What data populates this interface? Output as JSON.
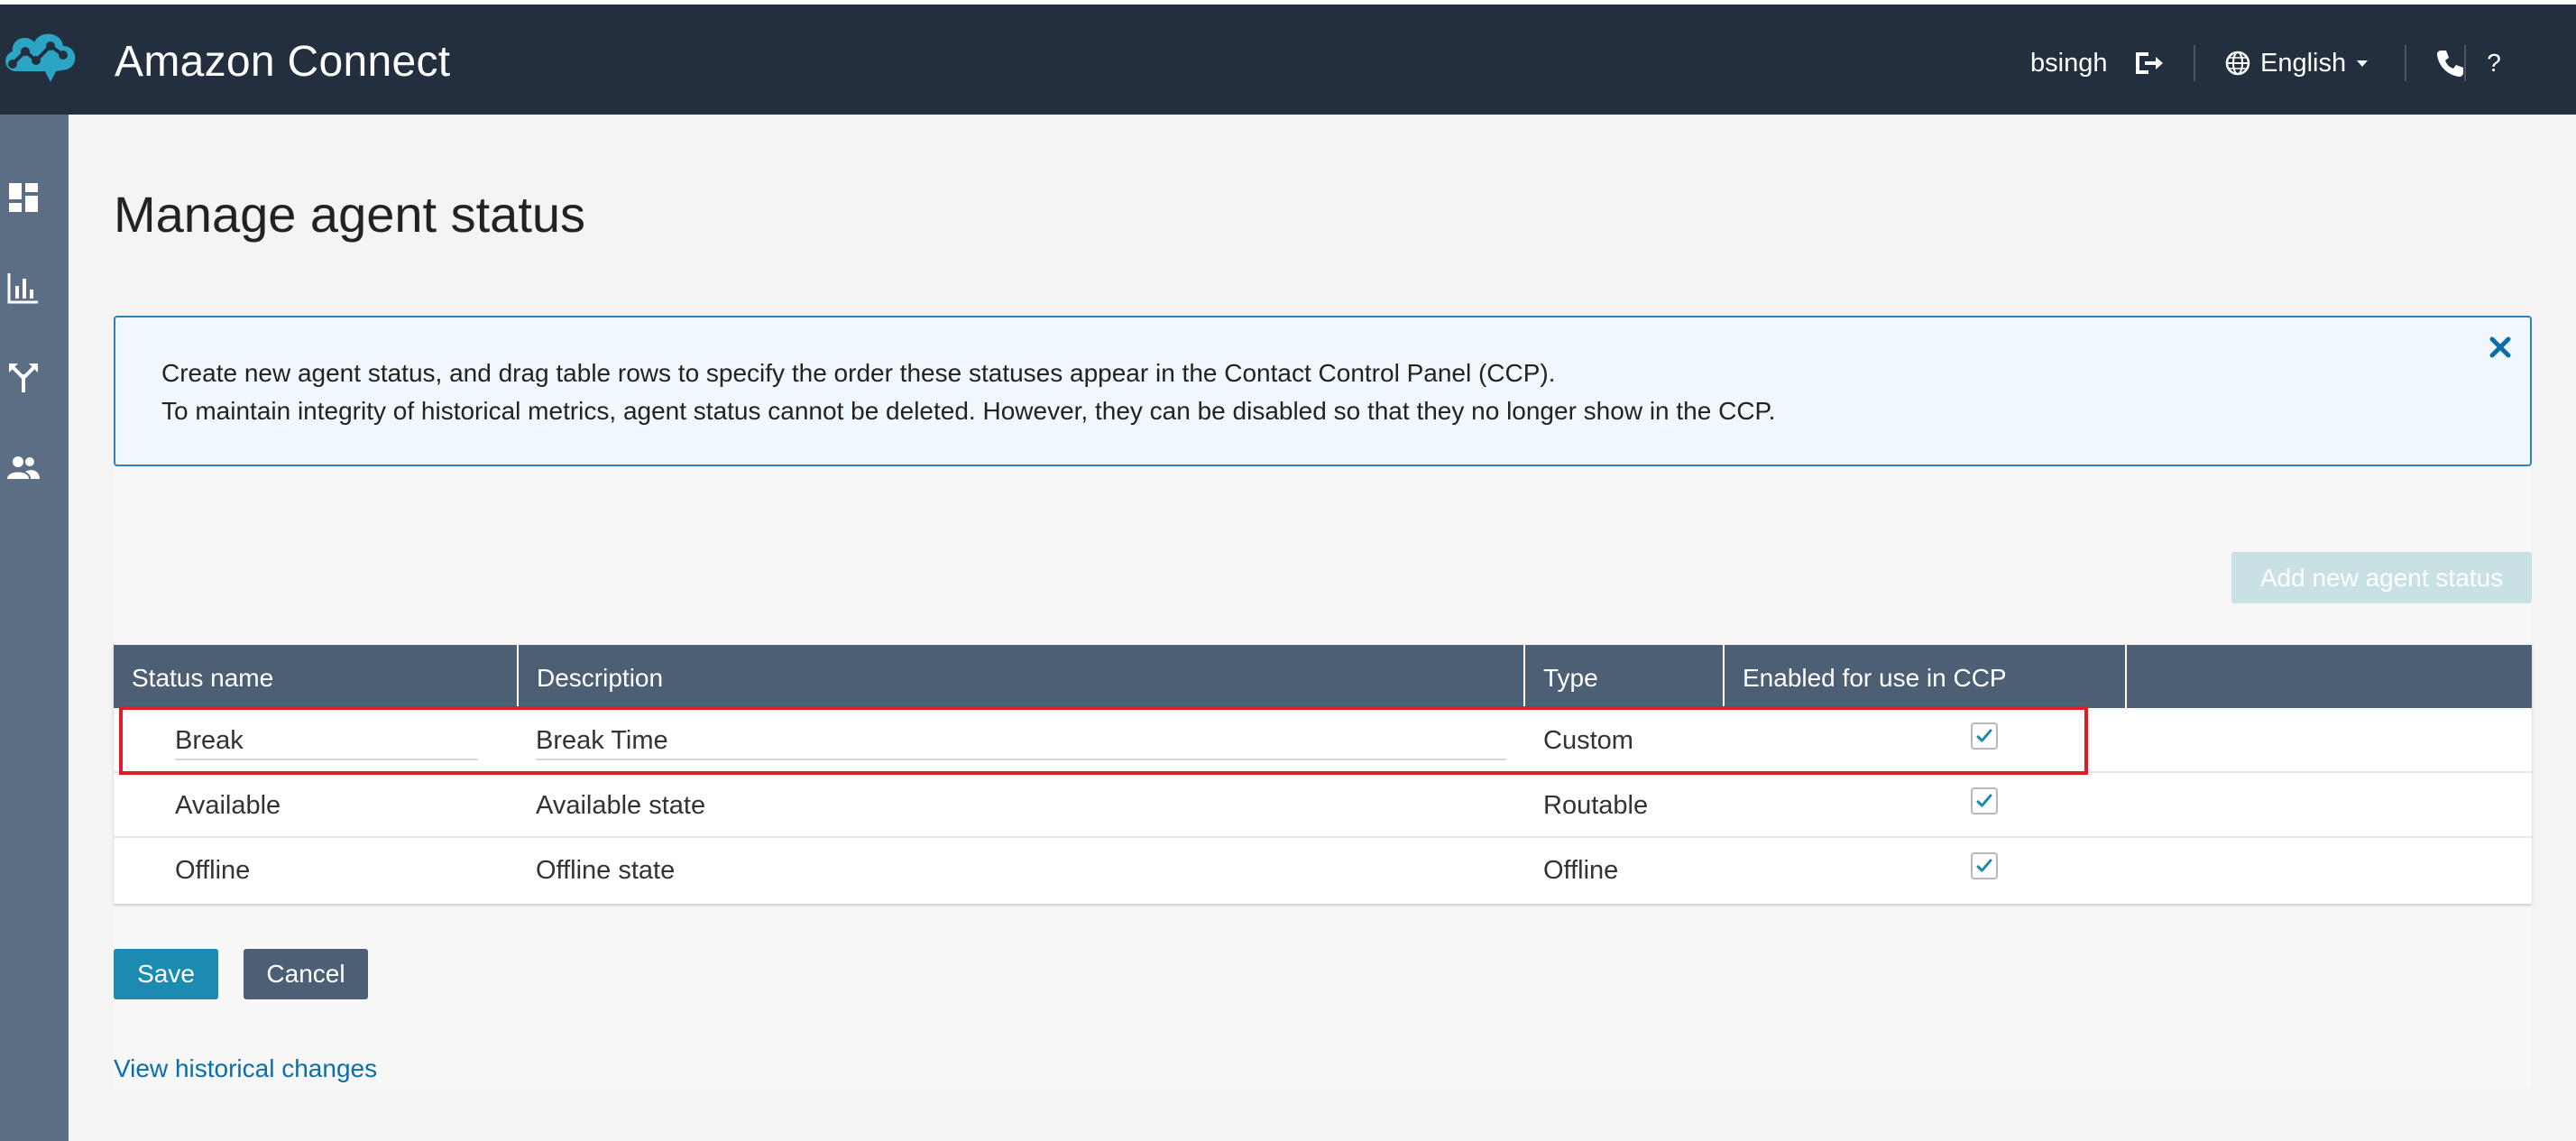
{
  "header": {
    "app_title": "Amazon Connect",
    "username": "bsingh",
    "language": "English",
    "help": "?",
    "icons": [
      "amazon-connect-logo-icon",
      "logout-icon",
      "globe-icon",
      "caret-down-icon",
      "phone-icon"
    ]
  },
  "sidebar": {
    "items": [
      {
        "icon": "dashboard-icon"
      },
      {
        "icon": "metrics-icon"
      },
      {
        "icon": "routing-icon"
      },
      {
        "icon": "users-icon"
      }
    ]
  },
  "page": {
    "title": "Manage agent status"
  },
  "info": {
    "line1": "Create new agent status, and drag table rows to specify the order these statuses appear in the Contact Control Panel (CCP).",
    "line2": "To maintain integrity of historical metrics, agent status cannot be deleted. However, they can be disabled so that they no longer show in the CCP."
  },
  "actions": {
    "add_label": "Add new agent status",
    "save_label": "Save",
    "cancel_label": "Cancel",
    "history_link": "View historical changes"
  },
  "table": {
    "columns": [
      "Status name",
      "Description",
      "Type",
      "Enabled for use in CCP"
    ],
    "rows": [
      {
        "name": "Break",
        "description": "Break Time",
        "type": "Custom",
        "enabled": true,
        "editing": true,
        "highlighted": true
      },
      {
        "name": "Available",
        "description": "Available state",
        "type": "Routable",
        "enabled": true
      },
      {
        "name": "Offline",
        "description": "Offline state",
        "type": "Offline",
        "enabled": true
      }
    ]
  },
  "colors": {
    "header_bg": "#232f3e",
    "sidebar_bg": "#5c6e84",
    "table_header_bg": "#4d5f74",
    "primary": "#1b8bb1",
    "link": "#0b6ea8",
    "highlight": "#e01c24",
    "check": "#1b8bb1"
  }
}
